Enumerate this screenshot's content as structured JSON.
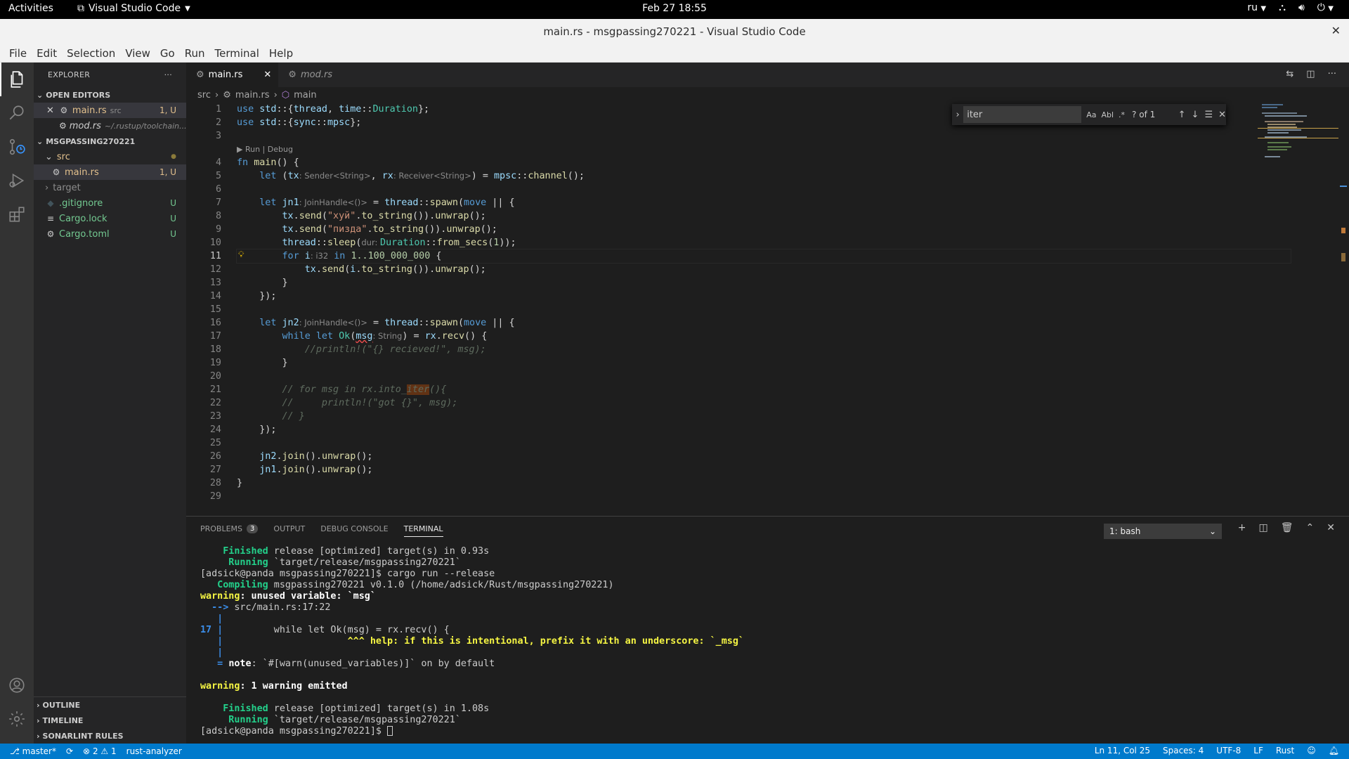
{
  "gnome": {
    "activities": "Activities",
    "app_name": "Visual Studio Code",
    "clock": "Feb 27  18:55",
    "keyboard_layout": "ru"
  },
  "window": {
    "title": "main.rs - msgpassing270221 - Visual Studio Code"
  },
  "menu": [
    "File",
    "Edit",
    "Selection",
    "View",
    "Go",
    "Run",
    "Terminal",
    "Help"
  ],
  "sidebar": {
    "header": "EXPLORER",
    "open_editors": {
      "label": "OPEN EDITORS",
      "items": [
        {
          "name": "main.rs",
          "desc": "src",
          "badge": "1, U"
        },
        {
          "name": "mod.rs",
          "desc": "~/.rustup/toolchain..."
        }
      ]
    },
    "project": {
      "label": "MSGPASSING270221",
      "items": [
        {
          "name": "src",
          "badge": "●"
        },
        {
          "name": "main.rs",
          "badge": "1, U"
        },
        {
          "name": "target"
        },
        {
          "name": ".gitignore",
          "badge": "U"
        },
        {
          "name": "Cargo.lock",
          "badge": "U"
        },
        {
          "name": "Cargo.toml",
          "badge": "U"
        }
      ]
    },
    "bottom_sections": [
      "OUTLINE",
      "TIMELINE",
      "SONARLINT RULES"
    ]
  },
  "tabs": [
    {
      "label": "main.rs",
      "active": true
    },
    {
      "label": "mod.rs",
      "active": false
    }
  ],
  "breadcrumbs": [
    "src",
    "main.rs",
    "main"
  ],
  "editor": {
    "line_numbers": [
      "1",
      "2",
      "3",
      "",
      "4",
      "5",
      "6",
      "7",
      "8",
      "9",
      "10",
      "11",
      "12",
      "13",
      "14",
      "15",
      "16",
      "17",
      "18",
      "19",
      "20",
      "21",
      "22",
      "23",
      "24",
      "25",
      "26",
      "27",
      "28",
      "29"
    ],
    "code_lens": "▶ Run | Debug",
    "lines": {
      "l1": [
        "use std::{thread, time::Duration};"
      ],
      "l2": [
        "use std::{sync::mpsc};"
      ],
      "l4": [
        "fn",
        " ",
        "main",
        "() {"
      ],
      "l5": [
        "    ",
        "let",
        " (",
        "tx",
        ": ",
        "Sender<String>",
        ", ",
        "rx",
        ": ",
        "Receiver<String>",
        ") = ",
        "mpsc",
        "::",
        "channel",
        "();"
      ],
      "l7": [
        "    ",
        "let",
        " ",
        "jn1",
        ": ",
        "JoinHandle<()>",
        " = ",
        "thread",
        "::",
        "spawn",
        "(",
        "move",
        " || {"
      ],
      "l8": [
        "        ",
        "tx",
        ".",
        "send",
        "(",
        "\"хуй\"",
        ".",
        "to_string",
        "()).",
        "unwrap",
        "();"
      ],
      "l9": [
        "        ",
        "tx",
        ".",
        "send",
        "(",
        "\"пизда\"",
        ".",
        "to_string",
        "()).",
        "unwrap",
        "();"
      ],
      "l10": [
        "        ",
        "thread",
        "::",
        "sleep",
        "(",
        "dur: ",
        "Duration",
        "::",
        "from_secs",
        "(",
        "1",
        "));"
      ],
      "l11": [
        "        ",
        "for",
        " ",
        "i",
        ": ",
        "i32",
        " ",
        "in",
        " ",
        "1..100_000_000",
        " {"
      ],
      "l12": [
        "            ",
        "tx",
        ".",
        "send",
        "(",
        "i",
        ".",
        "to_string",
        "()).",
        "unwrap",
        "();"
      ],
      "l13": [
        "        }"
      ],
      "l14": [
        "    });"
      ],
      "l16": [
        "    ",
        "let",
        " ",
        "jn2",
        ": ",
        "JoinHandle<()>",
        " = ",
        "thread",
        "::",
        "spawn",
        "(",
        "move",
        " || {"
      ],
      "l17": [
        "        ",
        "while",
        " ",
        "let",
        " ",
        "Ok",
        "(",
        "msg",
        ": ",
        "String",
        ") = ",
        "rx",
        ".",
        "recv",
        "() {"
      ],
      "l18": [
        "            ",
        "//println!(\"{} recieved!\", msg);"
      ],
      "l19": [
        "        }"
      ],
      "l21": [
        "        ",
        "// for msg in rx.into_",
        "iter",
        "(){"
      ],
      "l22": [
        "        ",
        "//     println!(\"got {}\", msg);"
      ],
      "l23": [
        "        ",
        "// }"
      ],
      "l24": [
        "    });"
      ],
      "l26": [
        "    ",
        "jn2",
        ".",
        "join",
        "().",
        "unwrap",
        "();"
      ],
      "l27": [
        "    ",
        "jn1",
        ".",
        "join",
        "().",
        "unwrap",
        "();"
      ],
      "l28": [
        "}"
      ]
    }
  },
  "find": {
    "value": "iter",
    "options": [
      "Aa",
      "Abl",
      ".*"
    ],
    "count": "? of 1"
  },
  "panel": {
    "tabs": [
      {
        "label": "PROBLEMS",
        "badge": "3"
      },
      {
        "label": "OUTPUT"
      },
      {
        "label": "DEBUG CONSOLE"
      },
      {
        "label": "TERMINAL",
        "active": true
      }
    ],
    "terminal_select": "1: bash",
    "terminal": {
      "t1a": "    Finished",
      "t1b": " release [optimized] target(s) in 0.93s",
      "t2a": "     Running",
      "t2b": " `target/release/msgpassing270221`",
      "t3": "[adsick@panda msgpassing270221]$ cargo run --release",
      "t4a": "   Compiling",
      "t4b": " msgpassing270221 v0.1.0 (/home/adsick/Rust/msgpassing270221)",
      "t5a": "warning",
      "t5b": ": unused variable: `msg`",
      "t6a": "  -->",
      "t6b": " src/main.rs:17:22",
      "t7": "   |",
      "t8a": "17",
      "t8b": " |",
      "t8c": "         while let Ok(msg) = rx.recv() {",
      "t9a": "   |",
      "t9b": "                      ^^^ help: if this is intentional, prefix it with an underscore: `_msg`",
      "t10": "   |",
      "t11a": "   = ",
      "t11b": "note",
      "t11c": ": `#[warn(unused_variables)]` on by default",
      "t13a": "warning",
      "t13b": ": 1 warning emitted",
      "t15a": "    Finished",
      "t15b": " release [optimized] target(s) in 1.08s",
      "t16a": "     Running",
      "t16b": " `target/release/msgpassing270221`",
      "t17": "[adsick@panda msgpassing270221]$ "
    }
  },
  "status": {
    "branch": "master*",
    "errors": "2",
    "warnings": "1",
    "lsp": "rust-analyzer",
    "position": "Ln 11, Col 25",
    "spaces": "Spaces: 4",
    "encoding": "UTF-8",
    "eol": "LF",
    "language": "Rust"
  },
  "colors": {
    "accent": "#007acc",
    "editor_bg": "#1e1e1e",
    "sidebar_bg": "#252526",
    "activity_bg": "#333333"
  }
}
